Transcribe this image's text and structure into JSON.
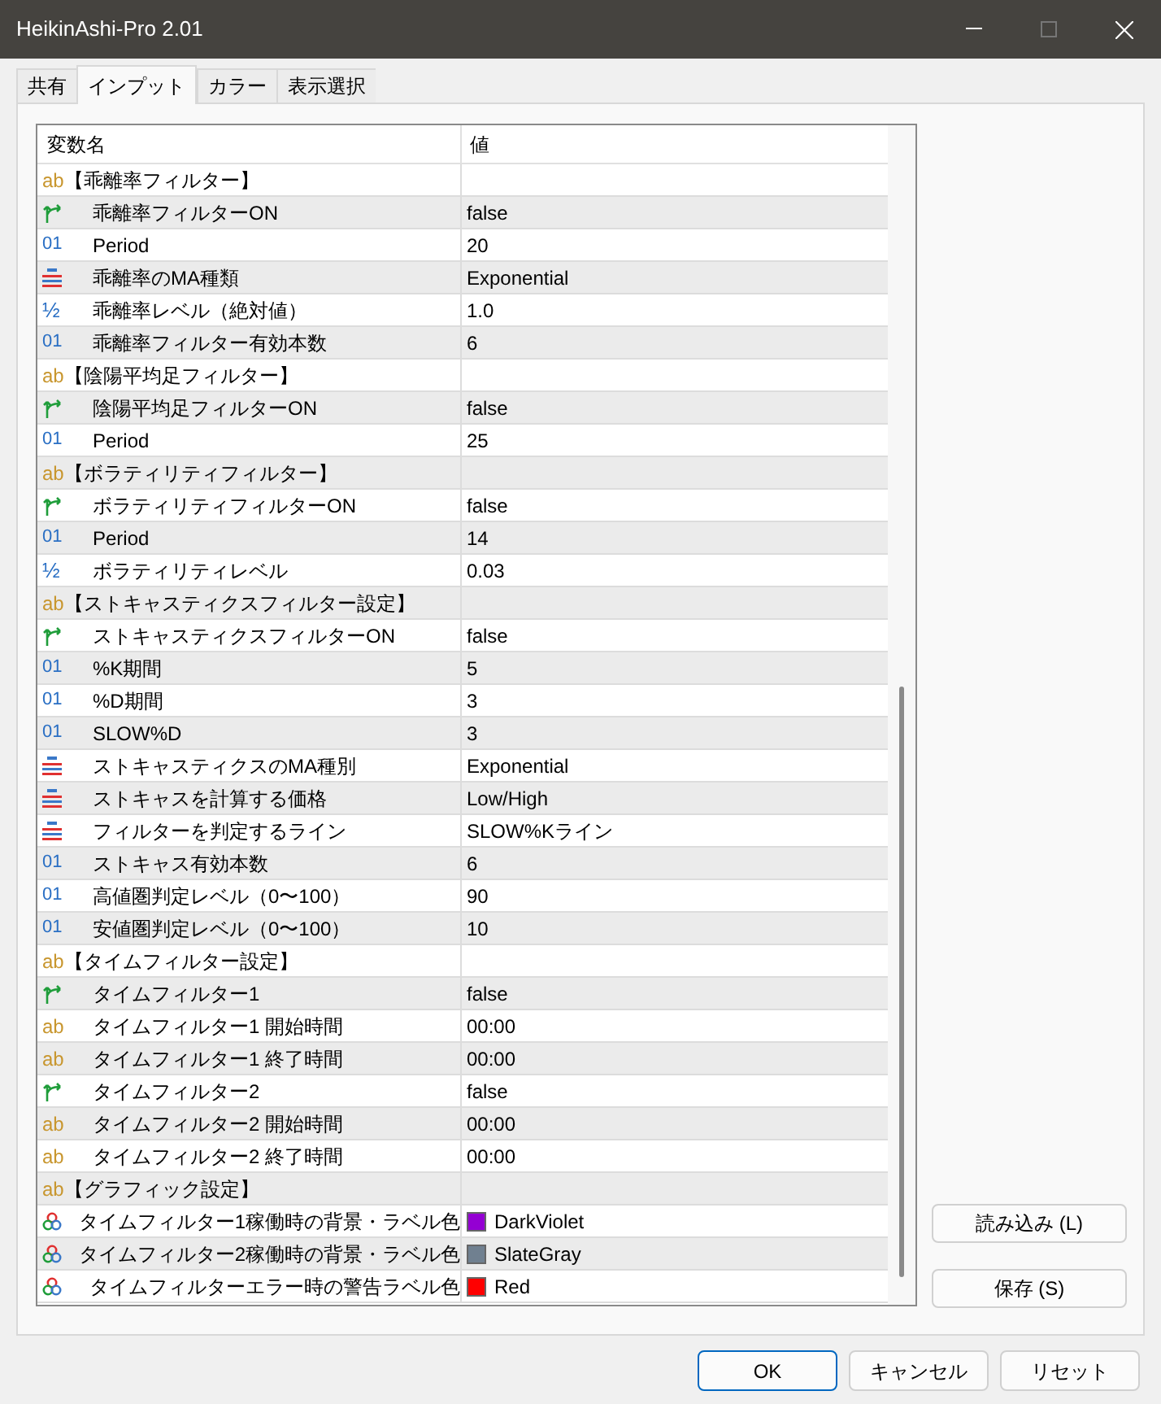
{
  "window": {
    "title": "HeikinAshi-Pro 2.01"
  },
  "tabs": [
    {
      "label": "共有",
      "selected": false
    },
    {
      "label": "インプット",
      "selected": true
    },
    {
      "label": "カラー",
      "selected": false
    },
    {
      "label": "表示選択",
      "selected": false
    }
  ],
  "table": {
    "columns": [
      "変数名",
      "値"
    ],
    "rows": [
      {
        "kind": "section",
        "icon": "ab",
        "name": "【乖離率フィルター】"
      },
      {
        "kind": "bool",
        "name": "乖離率フィルターON",
        "value": "false"
      },
      {
        "kind": "int",
        "icon": "01",
        "name": "Period",
        "value": "20"
      },
      {
        "kind": "enum",
        "name": "乖離率のMA種類",
        "value": "Exponential"
      },
      {
        "kind": "double",
        "icon": "½",
        "name": "乖離率レベル（絶対値）",
        "value": "1.0"
      },
      {
        "kind": "int",
        "icon": "01",
        "name": "乖離率フィルター有効本数",
        "value": "6"
      },
      {
        "kind": "section",
        "icon": "ab",
        "name": "【陰陽平均足フィルター】"
      },
      {
        "kind": "bool",
        "name": "陰陽平均足フィルターON",
        "value": "false"
      },
      {
        "kind": "int",
        "icon": "01",
        "name": "Period",
        "value": "25"
      },
      {
        "kind": "section",
        "icon": "ab",
        "name": "【ボラティリティフィルター】"
      },
      {
        "kind": "bool",
        "name": "ボラティリティフィルターON",
        "value": "false"
      },
      {
        "kind": "int",
        "icon": "01",
        "name": "Period",
        "value": "14"
      },
      {
        "kind": "double",
        "icon": "½",
        "name": "ボラティリティレベル",
        "value": "0.03"
      },
      {
        "kind": "section",
        "icon": "ab",
        "name": "【ストキャスティクスフィルター設定】"
      },
      {
        "kind": "bool",
        "name": "ストキャスティクスフィルターON",
        "value": "false"
      },
      {
        "kind": "int",
        "icon": "01",
        "name": "%K期間",
        "value": "5"
      },
      {
        "kind": "int",
        "icon": "01",
        "name": "%D期間",
        "value": "3"
      },
      {
        "kind": "int",
        "icon": "01",
        "name": "SLOW%D",
        "value": "3"
      },
      {
        "kind": "enum",
        "name": "ストキャスティクスのMA種別",
        "value": "Exponential"
      },
      {
        "kind": "enum",
        "name": "ストキャスを計算する価格",
        "value": "Low/High"
      },
      {
        "kind": "enum",
        "name": "フィルターを判定するライン",
        "value": "SLOW%Kライン"
      },
      {
        "kind": "int",
        "icon": "01",
        "name": "ストキャス有効本数",
        "value": "6"
      },
      {
        "kind": "int",
        "icon": "01",
        "name": "高値圏判定レベル（0〜100）",
        "value": "90"
      },
      {
        "kind": "int",
        "icon": "01",
        "name": "安値圏判定レベル（0〜100）",
        "value": "10"
      },
      {
        "kind": "section",
        "icon": "ab",
        "name": "【タイムフィルター設定】"
      },
      {
        "kind": "bool",
        "name": "タイムフィルター1",
        "value": "false"
      },
      {
        "kind": "string",
        "icon": "ab",
        "name": "タイムフィルター1 開始時間",
        "value": "00:00"
      },
      {
        "kind": "string",
        "icon": "ab",
        "name": "タイムフィルター1 終了時間",
        "value": "00:00"
      },
      {
        "kind": "bool",
        "name": "タイムフィルター2",
        "value": "false"
      },
      {
        "kind": "string",
        "icon": "ab",
        "name": "タイムフィルター2 開始時間",
        "value": "00:00"
      },
      {
        "kind": "string",
        "icon": "ab",
        "name": "タイムフィルター2 終了時間",
        "value": "00:00"
      },
      {
        "kind": "section",
        "icon": "ab",
        "name": "【グラフィック設定】"
      },
      {
        "kind": "color",
        "name": "タイムフィルター1稼働時の背景・ラベル色",
        "value": "DarkViolet",
        "color": "#9400d3"
      },
      {
        "kind": "color",
        "name": "タイムフィルター2稼働時の背景・ラベル色",
        "value": "SlateGray",
        "color": "#708090"
      },
      {
        "kind": "color",
        "name": "タイムフィルターエラー時の警告ラベル色",
        "value": "Red",
        "color": "#ff0000"
      }
    ]
  },
  "side_buttons": [
    "読み込み (L)",
    "保存 (S)"
  ],
  "buttons": [
    "OK",
    "キャンセル",
    "リセット"
  ]
}
